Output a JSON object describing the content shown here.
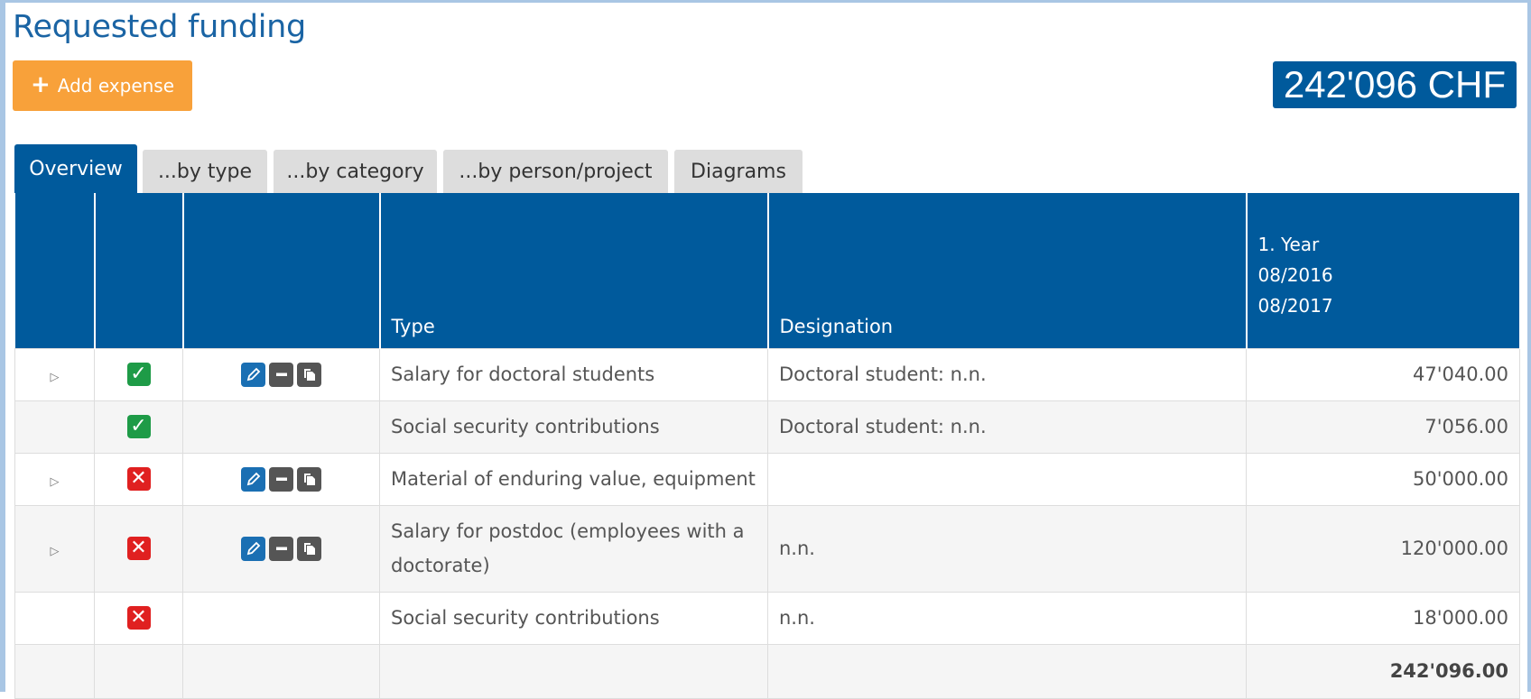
{
  "page_title": "Requested funding",
  "add_button_label": "Add expense",
  "total_badge": "242'096 CHF",
  "tabs": [
    {
      "label": "Overview"
    },
    {
      "label": "...by type"
    },
    {
      "label": "...by category"
    },
    {
      "label": "...by person/project"
    },
    {
      "label": "Diagrams"
    }
  ],
  "table": {
    "headers": {
      "type": "Type",
      "designation": "Designation",
      "year_line1": "1. Year",
      "year_line2": "08/2016",
      "year_line3": "08/2017"
    },
    "rows": [
      {
        "expandable": true,
        "status": "approved",
        "actions": true,
        "type": "Salary for doctoral students",
        "designation": "Doctoral student: n.n.",
        "amount": "47'040.00"
      },
      {
        "expandable": false,
        "status": "approved",
        "actions": false,
        "type": "Social security contributions",
        "designation": "Doctoral student: n.n.",
        "amount": "7'056.00"
      },
      {
        "expandable": true,
        "status": "rejected",
        "actions": true,
        "type": "Material of enduring value, equipment",
        "designation": "",
        "amount": "50'000.00"
      },
      {
        "expandable": true,
        "status": "rejected",
        "actions": true,
        "type": "Salary for postdoc (employees with a doctorate)",
        "designation": "n.n.",
        "amount": "120'000.00"
      },
      {
        "expandable": false,
        "status": "rejected",
        "actions": false,
        "type": "Social security contributions",
        "designation": "n.n.",
        "amount": "18'000.00"
      }
    ],
    "total": "242'096.00"
  },
  "colors": {
    "primary": "#005a9c",
    "accent": "#f8a13a",
    "approved": "#1e9b47",
    "rejected": "#e02020"
  },
  "icons": {
    "add": "plus-icon",
    "expand": "triangle-right-icon",
    "approved": "check-icon",
    "rejected": "x-icon",
    "edit": "pencil-icon",
    "remove": "minus-icon",
    "copy": "copy-icon"
  }
}
